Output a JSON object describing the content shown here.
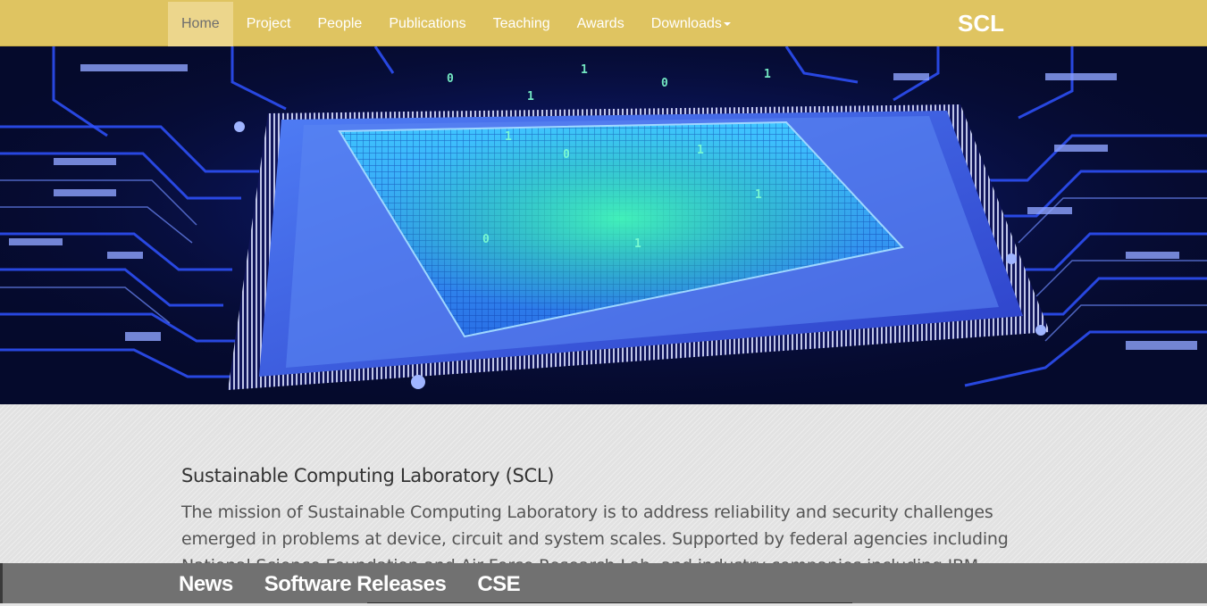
{
  "navbar": {
    "items": [
      {
        "label": "Home",
        "active": true
      },
      {
        "label": "Project"
      },
      {
        "label": "People"
      },
      {
        "label": "Publications"
      },
      {
        "label": "Teaching"
      },
      {
        "label": "Awards"
      },
      {
        "label": "Downloads",
        "dropdown": true
      }
    ],
    "brand": "SCL",
    "color": "#dfc461"
  },
  "hero": {
    "image": "circuit-chip-image"
  },
  "content": {
    "title": "Sustainable Computing Laboratory (SCL)",
    "mission": "The mission of Sustainable Computing Laboratory is to address reliability and security challenges emerged in problems at device, circuit and system scales. Supported by federal agencies including National Science Foundation and Air Force Research Lab, and industry companies including IBM"
  },
  "bottombar": {
    "links": [
      "News",
      "Software Releases",
      "CSE"
    ],
    "color": "#717171"
  }
}
